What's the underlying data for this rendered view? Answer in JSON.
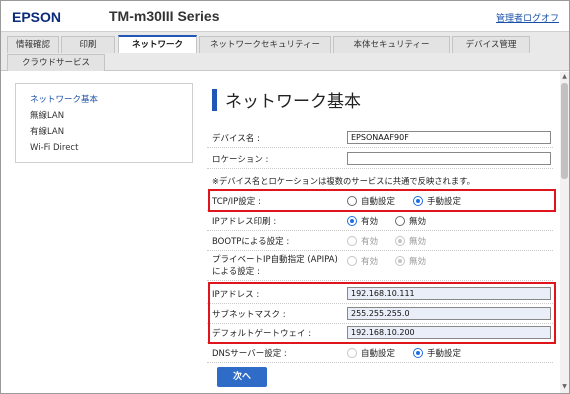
{
  "header": {
    "brand": "EPSON",
    "model": "TM-m30III Series",
    "logout": "管理者ログオフ"
  },
  "tabs": [
    {
      "label": "情報確認"
    },
    {
      "label": "印刷"
    },
    {
      "label": "ネットワーク",
      "active": true
    },
    {
      "label": "ネットワークセキュリティー"
    },
    {
      "label": "本体セキュリティー"
    },
    {
      "label": "デバイス管理"
    },
    {
      "label": "クラウドサービス"
    }
  ],
  "sidebar": {
    "items": [
      {
        "label": "ネットワーク基本",
        "active": true
      },
      {
        "label": "無線LAN"
      },
      {
        "label": "有線LAN"
      },
      {
        "label": "Wi-Fi Direct"
      }
    ]
  },
  "main": {
    "title": "ネットワーク基本",
    "device_name": {
      "label": "デバイス名 :",
      "value": "EPSONAAF90F"
    },
    "location": {
      "label": "ロケーション :",
      "value": ""
    },
    "note": "※デバイス名とロケーションは複数のサービスに共通で反映されます。",
    "tcpip": {
      "label": "TCP/IP設定 :",
      "opt_auto": "自動設定",
      "opt_manual": "手動設定",
      "selected": "手動設定"
    },
    "ip_print": {
      "label": "IPアドレス印刷 :",
      "opt_on": "有効",
      "opt_off": "無効",
      "selected": "有効"
    },
    "bootp": {
      "label": "BOOTPによる設定 :",
      "opt_on": "有効",
      "opt_off": "無効",
      "selected": "無効",
      "disabled": true
    },
    "apipa": {
      "label_line1": "プライベートIP自動指定 (APIPA)",
      "label_line2": "による設定 :",
      "opt_on": "有効",
      "opt_off": "無効",
      "selected": "無効",
      "disabled": true
    },
    "ip_address": {
      "label": "IPアドレス :",
      "value": "192.168.10.111"
    },
    "subnet": {
      "label": "サブネットマスク :",
      "value": "255.255.255.0"
    },
    "gateway": {
      "label": "デフォルトゲートウェイ :",
      "value": "192.168.10.200"
    },
    "dns": {
      "label": "DNSサーバー設定 :",
      "opt_auto": "自動設定",
      "opt_manual": "手動設定",
      "selected": "手動設定"
    },
    "next_button": "次へ"
  },
  "colors": {
    "accent": "#1f56b8",
    "highlight": "#e0141b",
    "button": "#2f6cc8"
  }
}
